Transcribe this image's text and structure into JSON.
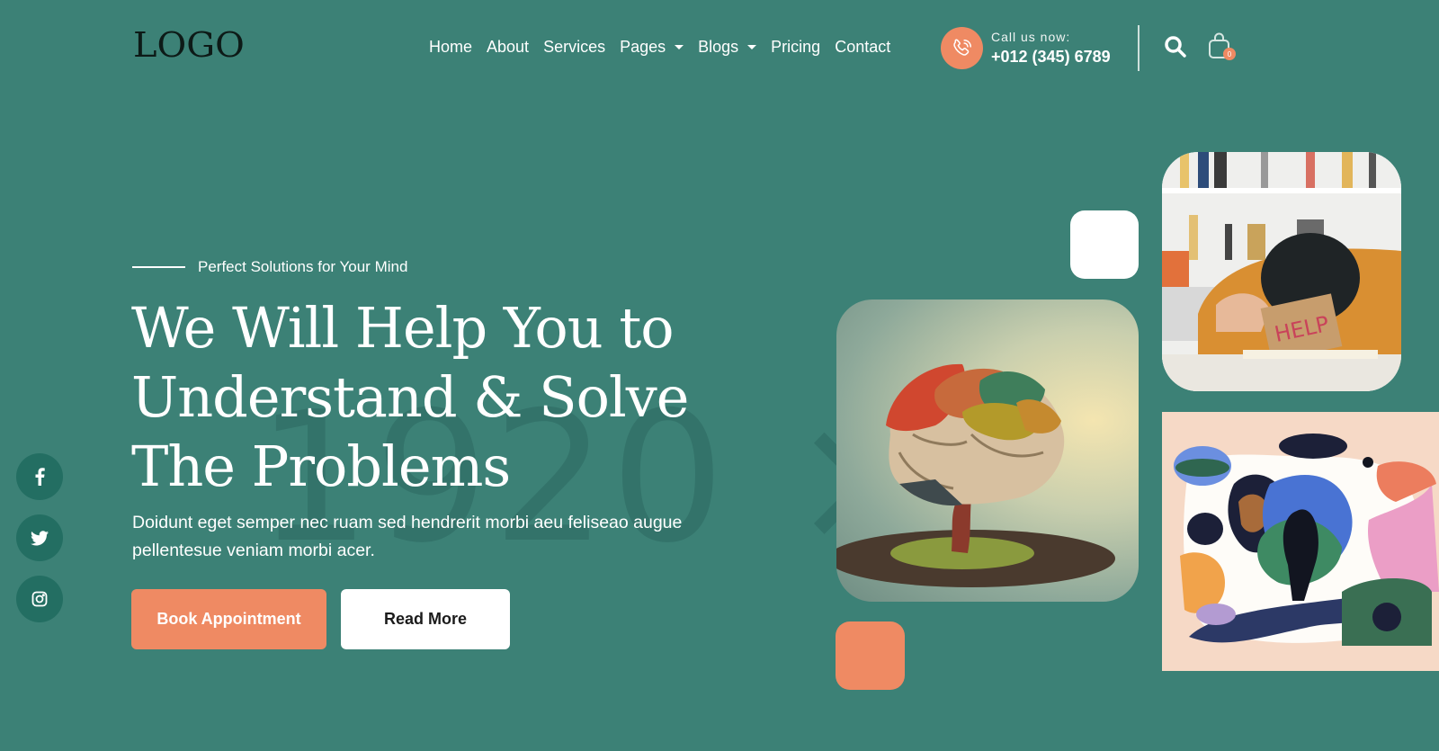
{
  "header": {
    "logo": "LOGO",
    "nav": [
      {
        "label": "Home",
        "has_dropdown": false
      },
      {
        "label": "About",
        "has_dropdown": false
      },
      {
        "label": "Services",
        "has_dropdown": false
      },
      {
        "label": "Pages",
        "has_dropdown": true
      },
      {
        "label": "Blogs",
        "has_dropdown": true
      },
      {
        "label": "Pricing",
        "has_dropdown": false
      },
      {
        "label": "Contact",
        "has_dropdown": false
      }
    ],
    "call": {
      "label": "Call us now:",
      "number": "+012 (345) 6789",
      "icon": "phone-ringing-icon"
    },
    "search_icon": "search-icon",
    "cart": {
      "icon": "shopping-bag-icon",
      "count": "0"
    }
  },
  "hero": {
    "subtitle": "Perfect Solutions for Your Mind",
    "title_lines": [
      "We Will Help You to",
      "Understand & Solve",
      "The Problems"
    ],
    "description": "Doidunt eget semper nec ruam sed hendrerit morbi aeu feliseao augue pellentesue veniam morbi acer.",
    "buttons": {
      "primary": "Book Appointment",
      "secondary": "Read More"
    },
    "watermark": "1920 × 1"
  },
  "social": [
    {
      "name": "facebook",
      "icon": "facebook-icon"
    },
    {
      "name": "twitter",
      "icon": "twitter-icon"
    },
    {
      "name": "instagram",
      "icon": "instagram-icon"
    }
  ],
  "images": {
    "brain": "Brain-shaped tree with colorful foliage",
    "help": "Person with head on desk holding HELP sign",
    "help_sign_text": "HELP",
    "art": "Abstract illustration of a person among colorful plants"
  },
  "colors": {
    "background": "#3c8176",
    "accent": "#ef8a63",
    "social_bg": "#236e62",
    "logo": "#0d1a17"
  }
}
